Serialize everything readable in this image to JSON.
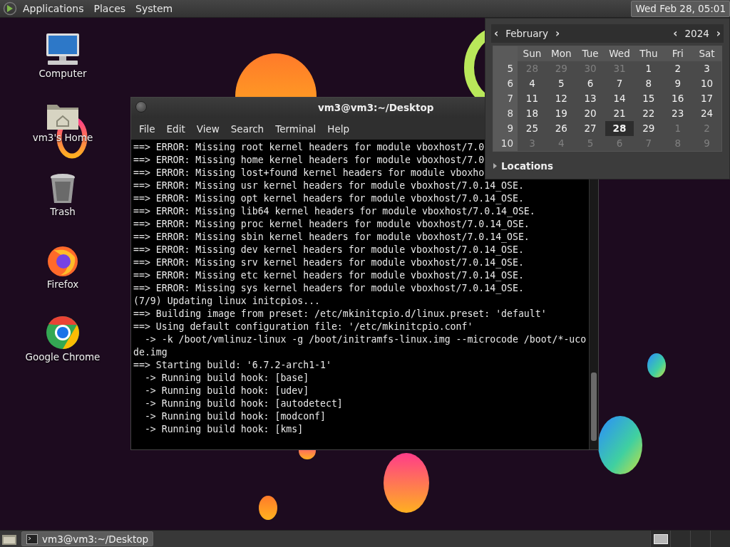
{
  "top_panel": {
    "menus": [
      "Applications",
      "Places",
      "System"
    ],
    "clock": {
      "label": "Wed Feb 28, 05:01",
      "pressed": true
    }
  },
  "desktop_icons": [
    {
      "kind": "computer",
      "label": "Computer"
    },
    {
      "kind": "home",
      "label": "vm3's Home"
    },
    {
      "kind": "trash",
      "label": "Trash"
    },
    {
      "kind": "firefox",
      "label": "Firefox"
    },
    {
      "kind": "chrome",
      "label": "Google Chrome"
    }
  ],
  "terminal": {
    "title": "vm3@vm3:~/Desktop",
    "menus": [
      "File",
      "Edit",
      "View",
      "Search",
      "Terminal",
      "Help"
    ],
    "lines": [
      "==> ERROR: Missing root kernel headers for module vboxhost/7.0",
      "==> ERROR: Missing home kernel headers for module vboxhost/7.0",
      "==> ERROR: Missing lost+found kernel headers for module vboxho",
      "==> ERROR: Missing usr kernel headers for module vboxhost/7.0.14_OSE.",
      "==> ERROR: Missing opt kernel headers for module vboxhost/7.0.14_OSE.",
      "==> ERROR: Missing lib64 kernel headers for module vboxhost/7.0.14_OSE.",
      "==> ERROR: Missing proc kernel headers for module vboxhost/7.0.14_OSE.",
      "==> ERROR: Missing sbin kernel headers for module vboxhost/7.0.14_OSE.",
      "==> ERROR: Missing dev kernel headers for module vboxhost/7.0.14_OSE.",
      "==> ERROR: Missing srv kernel headers for module vboxhost/7.0.14_OSE.",
      "==> ERROR: Missing etc kernel headers for module vboxhost/7.0.14_OSE.",
      "==> ERROR: Missing sys kernel headers for module vboxhost/7.0.14_OSE.",
      "(7/9) Updating linux initcpios...",
      "==> Building image from preset: /etc/mkinitcpio.d/linux.preset: 'default'",
      "==> Using default configuration file: '/etc/mkinitcpio.conf'",
      "  -> -k /boot/vmlinuz-linux -g /boot/initramfs-linux.img --microcode /boot/*-uco",
      "de.img",
      "==> Starting build: '6.7.2-arch1-1'",
      "  -> Running build hook: [base]",
      "  -> Running build hook: [udev]",
      "  -> Running build hook: [autodetect]",
      "  -> Running build hook: [modconf]",
      "  -> Running build hook: [kms]"
    ]
  },
  "calendar": {
    "prev_month": "‹",
    "month": "February",
    "next_month": "›",
    "prev_year": "‹",
    "year": "2024",
    "next_year": "›",
    "weekdays": [
      "Sun",
      "Mon",
      "Tue",
      "Wed",
      "Thu",
      "Fri",
      "Sat"
    ],
    "weeks": [
      {
        "number": "5",
        "days": [
          {
            "day": "28",
            "other_month": true,
            "selected": false
          },
          {
            "day": "29",
            "other_month": true,
            "selected": false
          },
          {
            "day": "30",
            "other_month": true,
            "selected": false
          },
          {
            "day": "31",
            "other_month": true,
            "selected": false
          },
          {
            "day": "1",
            "other_month": false,
            "selected": false
          },
          {
            "day": "2",
            "other_month": false,
            "selected": false
          },
          {
            "day": "3",
            "other_month": false,
            "selected": false
          }
        ]
      },
      {
        "number": "6",
        "days": [
          {
            "day": "4",
            "other_month": false,
            "selected": false
          },
          {
            "day": "5",
            "other_month": false,
            "selected": false
          },
          {
            "day": "6",
            "other_month": false,
            "selected": false
          },
          {
            "day": "7",
            "other_month": false,
            "selected": false
          },
          {
            "day": "8",
            "other_month": false,
            "selected": false
          },
          {
            "day": "9",
            "other_month": false,
            "selected": false
          },
          {
            "day": "10",
            "other_month": false,
            "selected": false
          }
        ]
      },
      {
        "number": "7",
        "days": [
          {
            "day": "11",
            "other_month": false,
            "selected": false
          },
          {
            "day": "12",
            "other_month": false,
            "selected": false
          },
          {
            "day": "13",
            "other_month": false,
            "selected": false
          },
          {
            "day": "14",
            "other_month": false,
            "selected": false
          },
          {
            "day": "15",
            "other_month": false,
            "selected": false
          },
          {
            "day": "16",
            "other_month": false,
            "selected": false
          },
          {
            "day": "17",
            "other_month": false,
            "selected": false
          }
        ]
      },
      {
        "number": "8",
        "days": [
          {
            "day": "18",
            "other_month": false,
            "selected": false
          },
          {
            "day": "19",
            "other_month": false,
            "selected": false
          },
          {
            "day": "20",
            "other_month": false,
            "selected": false
          },
          {
            "day": "21",
            "other_month": false,
            "selected": false
          },
          {
            "day": "22",
            "other_month": false,
            "selected": false
          },
          {
            "day": "23",
            "other_month": false,
            "selected": false
          },
          {
            "day": "24",
            "other_month": false,
            "selected": false
          }
        ]
      },
      {
        "number": "9",
        "days": [
          {
            "day": "25",
            "other_month": false,
            "selected": false
          },
          {
            "day": "26",
            "other_month": false,
            "selected": false
          },
          {
            "day": "27",
            "other_month": false,
            "selected": false
          },
          {
            "day": "28",
            "other_month": false,
            "selected": true
          },
          {
            "day": "29",
            "other_month": false,
            "selected": false
          },
          {
            "day": "1",
            "other_month": true,
            "selected": false
          },
          {
            "day": "2",
            "other_month": true,
            "selected": false
          }
        ]
      },
      {
        "number": "10",
        "days": [
          {
            "day": "3",
            "other_month": true,
            "selected": false
          },
          {
            "day": "4",
            "other_month": true,
            "selected": false
          },
          {
            "day": "5",
            "other_month": true,
            "selected": false
          },
          {
            "day": "6",
            "other_month": true,
            "selected": false
          },
          {
            "day": "7",
            "other_month": true,
            "selected": false
          },
          {
            "day": "8",
            "other_month": true,
            "selected": false
          },
          {
            "day": "9",
            "other_month": true,
            "selected": false
          }
        ]
      }
    ],
    "locations": {
      "label": "Locations",
      "expanded": false
    }
  },
  "taskbar": {
    "tasks": [
      {
        "label": "vm3@vm3:~/Desktop",
        "selected": true
      }
    ],
    "workspaces": [
      {
        "selected": true
      },
      {
        "selected": false
      },
      {
        "selected": false
      },
      {
        "selected": false
      }
    ]
  }
}
